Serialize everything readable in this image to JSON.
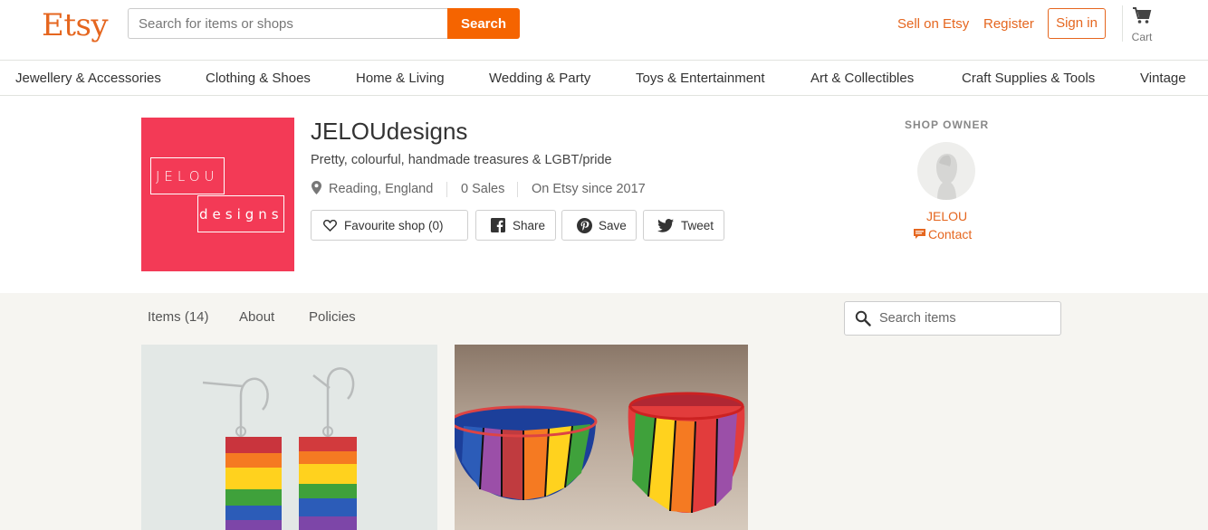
{
  "header": {
    "logo": "Etsy",
    "search_placeholder": "Search for items or shops",
    "search_button": "Search",
    "sell_link": "Sell on Etsy",
    "register_link": "Register",
    "signin_button": "Sign in",
    "cart_label": "Cart"
  },
  "categories": [
    "Jewellery & Accessories",
    "Clothing & Shoes",
    "Home & Living",
    "Wedding & Party",
    "Toys & Entertainment",
    "Art & Collectibles",
    "Craft Supplies & Tools",
    "Vintage"
  ],
  "shop": {
    "logo_text_top": "JELOU",
    "logo_text_bottom": "designs",
    "name": "JELOUdesigns",
    "tagline": "Pretty, colourful, handmade treasures & LGBT/pride",
    "location": "Reading, England",
    "sales": "0 Sales",
    "since": "On Etsy since 2017",
    "favourite_button": "Favourite shop (0)",
    "share_button": "Share",
    "save_button": "Save",
    "tweet_button": "Tweet",
    "brand_color": "#f33a56"
  },
  "owner": {
    "heading": "SHOP OWNER",
    "name": "JELOU",
    "contact": "Contact"
  },
  "tabs": {
    "items": "Items (14)",
    "about": "About",
    "policies": "Policies",
    "search_placeholder": "Search items"
  },
  "listings": [
    {
      "image": "rainbow-earrings"
    },
    {
      "image": "rainbow-bowls"
    }
  ],
  "colors": {
    "accent": "#f56400",
    "link": "#e5661f"
  }
}
